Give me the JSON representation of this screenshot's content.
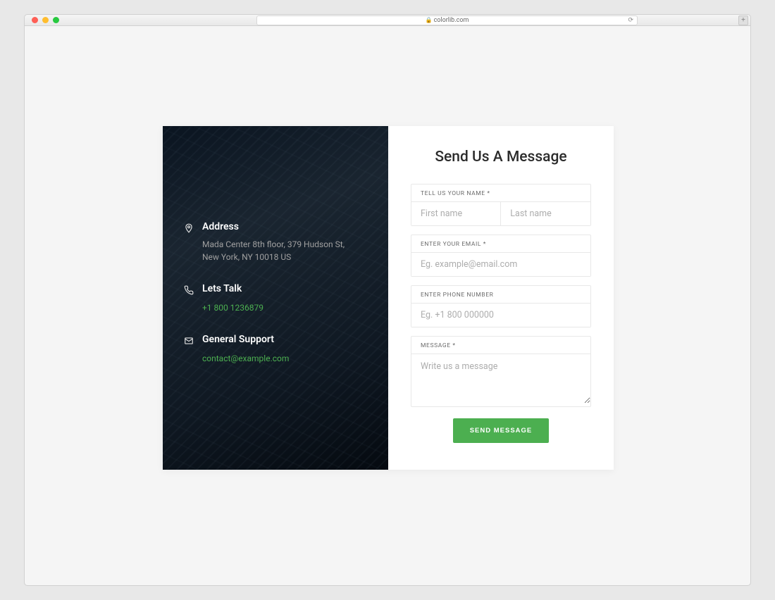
{
  "browser": {
    "url": "colorlib.com"
  },
  "info": {
    "address": {
      "title": "Address",
      "line1": "Mada Center 8th floor, 379 Hudson St,",
      "line2": "New York, NY 10018 US"
    },
    "phone": {
      "title": "Lets Talk",
      "value": "+1 800 1236879"
    },
    "support": {
      "title": "General Support",
      "value": "contact@example.com"
    }
  },
  "form": {
    "title": "Send Us A Message",
    "name_label": "TELL US YOUR NAME *",
    "first_name_placeholder": "First name",
    "last_name_placeholder": "Last name",
    "email_label": "ENTER YOUR EMAIL *",
    "email_placeholder": "Eg. example@email.com",
    "phone_label": "ENTER PHONE NUMBER",
    "phone_placeholder": "Eg. +1 800 000000",
    "message_label": "MESSAGE *",
    "message_placeholder": "Write us a message",
    "submit_label": "SEND MESSAGE"
  },
  "colors": {
    "accent": "#4caf50"
  }
}
